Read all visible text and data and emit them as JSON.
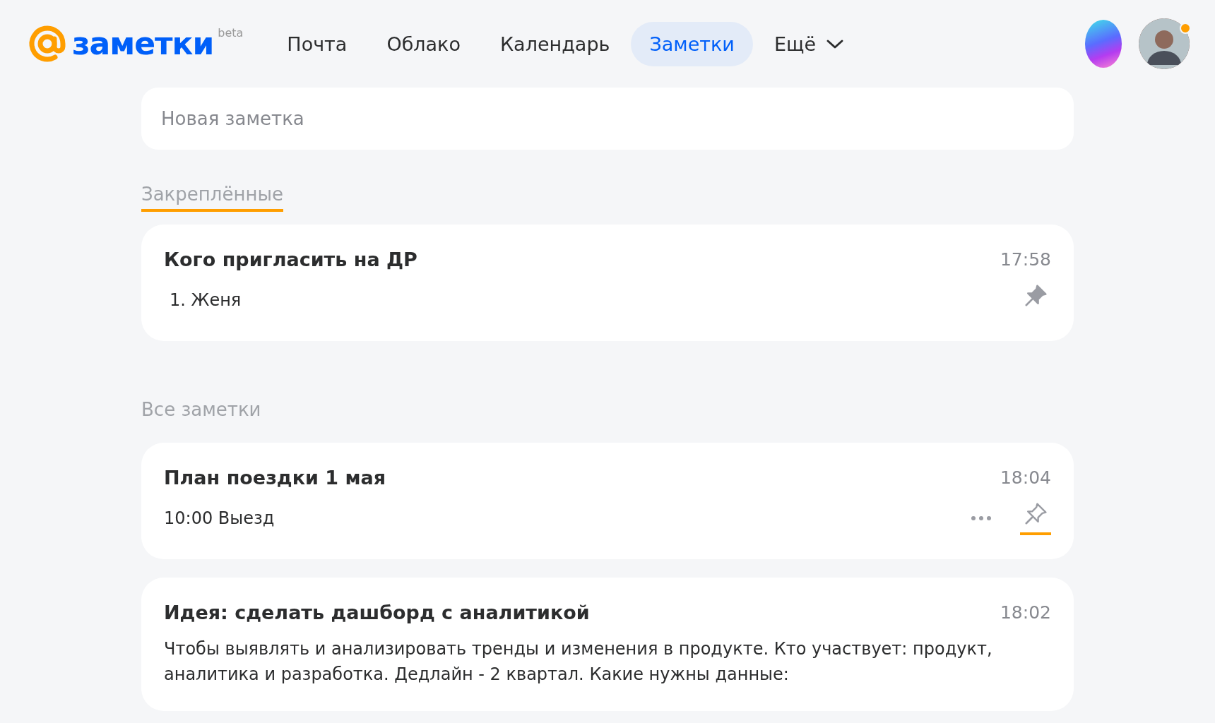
{
  "header": {
    "logo": {
      "text": "заметки",
      "badge": "beta"
    },
    "nav": [
      {
        "label": "Почта",
        "selected": false
      },
      {
        "label": "Облако",
        "selected": false
      },
      {
        "label": "Календарь",
        "selected": false
      },
      {
        "label": "Заметки",
        "selected": true
      },
      {
        "label": "Ещё",
        "selected": false,
        "kind": "dropdown"
      }
    ],
    "avatar": {
      "notification": true
    }
  },
  "new_note": {
    "placeholder": "Новая заметка"
  },
  "sections": [
    {
      "title": "Закреплённые",
      "selected": true,
      "notes": [
        {
          "title": "Кого пригласить на ДР",
          "time": "17:58",
          "kind": "list",
          "body": "1. Женя",
          "pinned": true,
          "hovered": false
        }
      ]
    },
    {
      "title": "Все заметки",
      "selected": false,
      "notes": [
        {
          "title": "План поездки 1 мая",
          "time": "18:04",
          "kind": "text",
          "body": "10:00 Выезд",
          "pinned": false,
          "hovered": true
        },
        {
          "title": "Идея: сделать дашборд с аналитикой",
          "time": "18:02",
          "kind": "text",
          "body": "Чтобы выявлять и анализировать тренды и изменения в продукте. Кто участвует: продукт, аналитика и разработка. Дедлайн - 2 квартал. Какие нужны данные:",
          "pinned": false,
          "hovered": false
        }
      ]
    }
  ]
}
